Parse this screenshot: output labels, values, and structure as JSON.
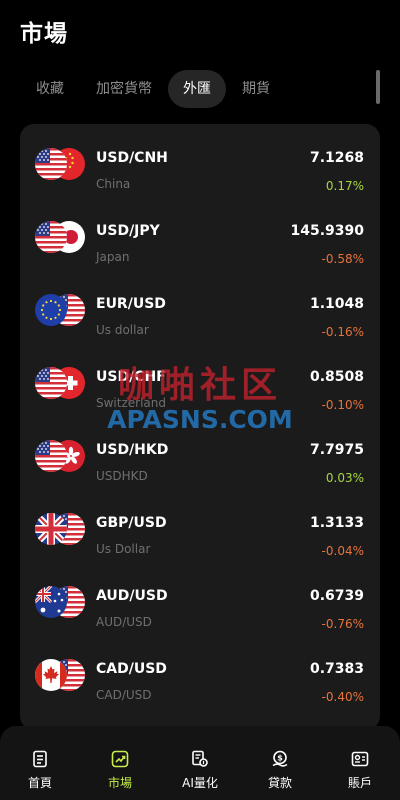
{
  "header": {
    "title": "市場"
  },
  "tabs": [
    {
      "label": "收藏",
      "active": false
    },
    {
      "label": "加密貨幣",
      "active": false
    },
    {
      "label": "外匯",
      "active": true
    },
    {
      "label": "期貨",
      "active": false
    }
  ],
  "rows": [
    {
      "pair": "USD/CNH",
      "sub": "China",
      "price": "7.1268",
      "change": "0.17%",
      "direction": "up",
      "flag": "cn-flag-icon"
    },
    {
      "pair": "USD/JPY",
      "sub": "Japan",
      "price": "145.9390",
      "change": "-0.58%",
      "direction": "down",
      "flag": "jp-flag-icon"
    },
    {
      "pair": "EUR/USD",
      "sub": "Us dollar",
      "price": "1.1048",
      "change": "-0.16%",
      "direction": "down",
      "flag": "eu-flag-icon"
    },
    {
      "pair": "USD/CHF",
      "sub": "Switzerland",
      "price": "0.8508",
      "change": "-0.10%",
      "direction": "down",
      "flag": "ch-flag-icon"
    },
    {
      "pair": "USD/HKD",
      "sub": "USDHKD",
      "price": "7.7975",
      "change": "0.03%",
      "direction": "up",
      "flag": "hk-flag-icon"
    },
    {
      "pair": "GBP/USD",
      "sub": "Us Dollar",
      "price": "1.3133",
      "change": "-0.04%",
      "direction": "down",
      "flag": "gb-flag-icon"
    },
    {
      "pair": "AUD/USD",
      "sub": "AUD/USD",
      "price": "0.6739",
      "change": "-0.76%",
      "direction": "down",
      "flag": "au-flag-icon"
    },
    {
      "pair": "CAD/USD",
      "sub": "CAD/USD",
      "price": "0.7383",
      "change": "-0.40%",
      "direction": "down",
      "flag": "ca-flag-icon"
    }
  ],
  "watermark": {
    "line1": "咖啪社区",
    "line2": "APASNS.COM"
  },
  "bottom_nav": [
    {
      "label": "首頁",
      "icon": "home-icon",
      "active": false
    },
    {
      "label": "市場",
      "icon": "market-icon",
      "active": true
    },
    {
      "label": "AI量化",
      "icon": "ai-quant-icon",
      "active": false
    },
    {
      "label": "貸款",
      "icon": "loan-icon",
      "active": false
    },
    {
      "label": "賬戶",
      "icon": "account-icon",
      "active": false
    }
  ],
  "colors": {
    "accent": "#c6ef4a",
    "up": "#a6d643",
    "down": "#e5733c",
    "card": "#1b1b1b",
    "background": "#000000"
  }
}
